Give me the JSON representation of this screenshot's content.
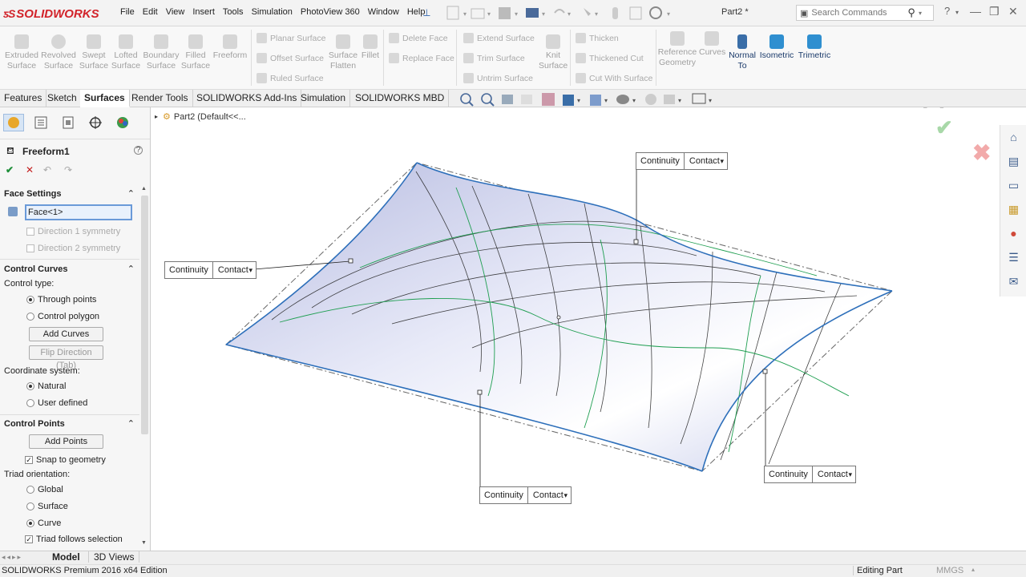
{
  "app": {
    "brand": "SOLIDWORKS",
    "doc_title": "Part2 *"
  },
  "menu": [
    "File",
    "Edit",
    "View",
    "Insert",
    "Tools",
    "Simulation",
    "PhotoView 360",
    "Window",
    "Help"
  ],
  "search": {
    "placeholder": "Search Commands"
  },
  "ribbon": {
    "big_buttons": [
      {
        "label": "Extruded\nSurface"
      },
      {
        "label": "Revolved\nSurface"
      },
      {
        "label": "Swept\nSurface"
      },
      {
        "label": "Lofted\nSurface"
      },
      {
        "label": "Boundary\nSurface"
      },
      {
        "label": "Filled\nSurface"
      },
      {
        "label": "Freeform"
      }
    ],
    "col1": [
      "Planar Surface",
      "Offset Surface",
      "Ruled Surface"
    ],
    "mid_buttons": [
      "Surface\nFlatten",
      "Fillet"
    ],
    "col2": [
      "Delete Face",
      "Replace Face"
    ],
    "col3": [
      "Extend Surface",
      "Trim Surface",
      "Untrim Surface"
    ],
    "knit": "Knit\nSurface",
    "col4": [
      "Thicken",
      "Thickened Cut",
      "Cut With Surface"
    ],
    "ref_geom": "Reference\nGeometry",
    "curves": "Curves",
    "views": [
      "Normal\nTo",
      "Isometric",
      "Trimetric"
    ]
  },
  "tabs": [
    "Features",
    "Sketch",
    "Surfaces",
    "Render Tools",
    "SOLIDWORKS Add-Ins",
    "Simulation",
    "SOLIDWORKS MBD"
  ],
  "active_tab": "Surfaces",
  "panel": {
    "title": "Freeform1",
    "face_settings": {
      "header": "Face Settings",
      "face_value": "Face<1>",
      "dir1": "Direction 1 symmetry",
      "dir2": "Direction 2 symmetry"
    },
    "control_curves": {
      "header": "Control Curves",
      "control_type_label": "Control type:",
      "through_points": "Through points",
      "control_polygon": "Control polygon",
      "add_curves": "Add Curves",
      "flip_direction": "Flip Direction (Tab)",
      "coord_label": "Coordinate system:",
      "natural": "Natural",
      "user_defined": "User defined"
    },
    "control_points": {
      "header": "Control Points",
      "add_points": "Add Points",
      "snap": "Snap to geometry",
      "triad_label": "Triad orientation:",
      "global": "Global",
      "surface": "Surface",
      "curve": "Curve",
      "triad_follows": "Triad follows selection"
    }
  },
  "viewport": {
    "breadcrumb": "Part2  (Default<<...",
    "continuity_boxes": [
      {
        "label": "Continuity",
        "value": "Contact"
      },
      {
        "label": "Continuity",
        "value": "Contact"
      },
      {
        "label": "Continuity",
        "value": "Contact"
      },
      {
        "label": "Continuity",
        "value": "Contact"
      }
    ]
  },
  "bottom_tabs": [
    "Model",
    "3D Views"
  ],
  "status": {
    "edition": "SOLIDWORKS Premium 2016 x64 Edition",
    "mode": "Editing Part",
    "units": "MMGS"
  },
  "colors": {
    "accent": "#d2232a",
    "surface": "#c7cce8",
    "edge": "#2d6fba",
    "green_iso": "#1e9e50"
  }
}
